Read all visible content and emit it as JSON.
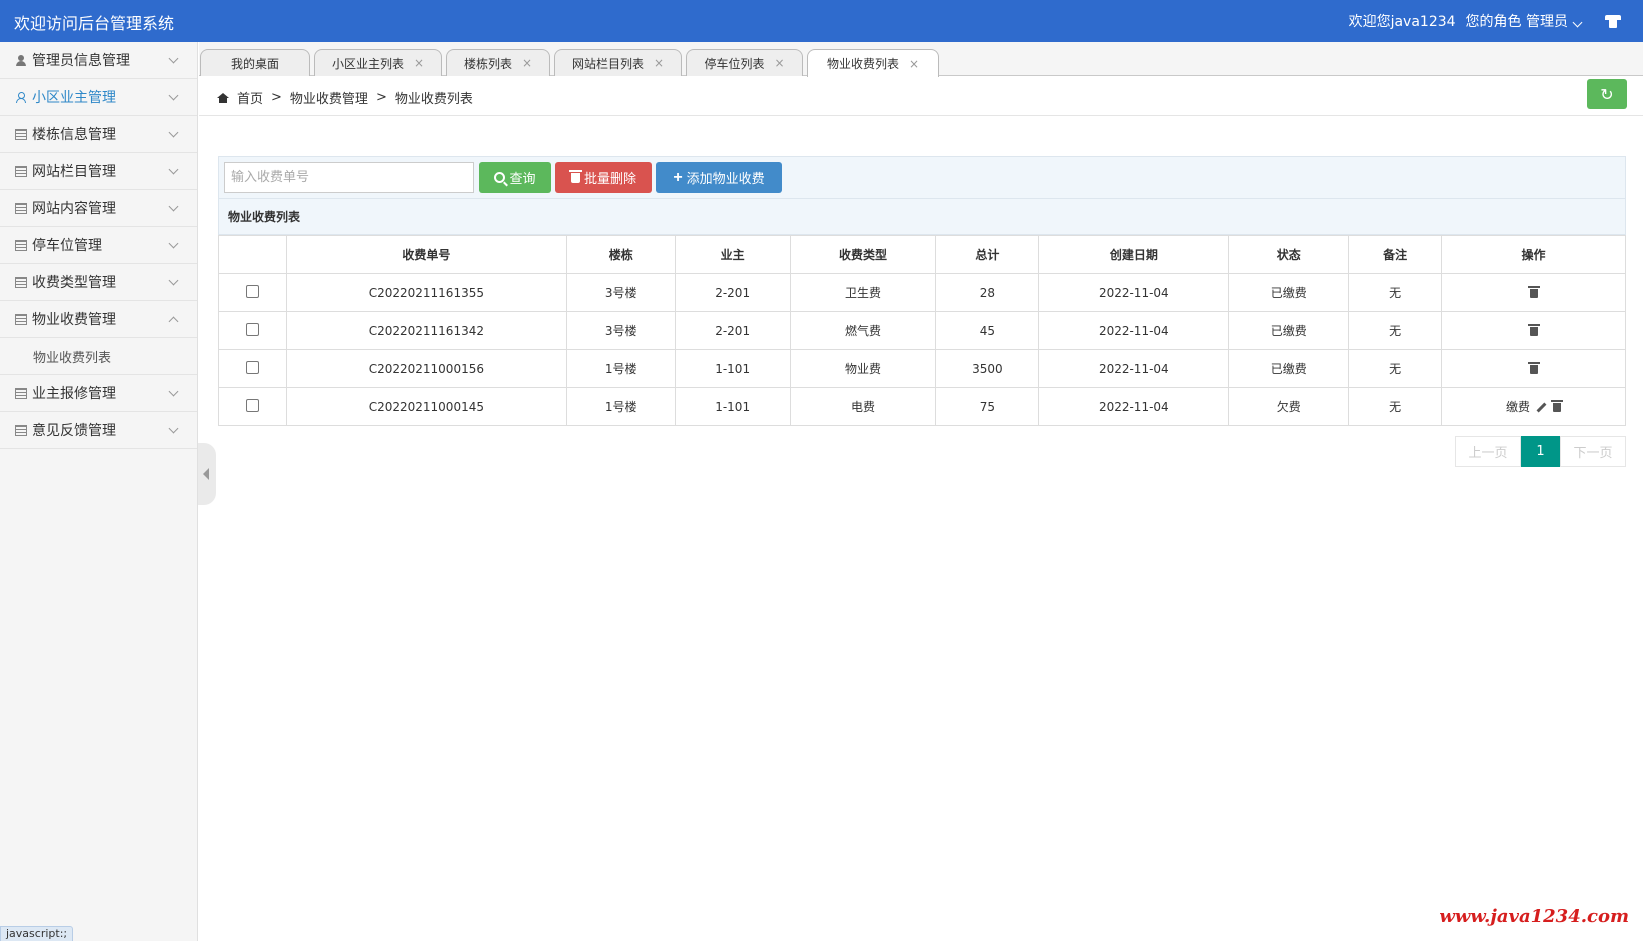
{
  "header": {
    "title": "欢迎访问后台管理系统",
    "welcome": "欢迎您java1234",
    "role": "您的角色 管理员"
  },
  "sidebar": {
    "items": [
      {
        "label": "管理员信息管理",
        "icon": "user-icon"
      },
      {
        "label": "小区业主管理",
        "icon": "user-outline-icon",
        "active": true
      },
      {
        "label": "楼栋信息管理",
        "icon": "list-icon"
      },
      {
        "label": "网站栏目管理",
        "icon": "list-icon"
      },
      {
        "label": "网站内容管理",
        "icon": "list-icon"
      },
      {
        "label": "停车位管理",
        "icon": "list-icon"
      },
      {
        "label": "收费类型管理",
        "icon": "list-icon"
      },
      {
        "label": "物业收费管理",
        "icon": "list-icon",
        "expanded": true
      },
      {
        "label": "业主报修管理",
        "icon": "list-icon"
      },
      {
        "label": "意见反馈管理",
        "icon": "list-icon"
      }
    ],
    "sub_item": "物业收费列表"
  },
  "status_tip": "javascript:;",
  "tabs": [
    {
      "label": "我的桌面"
    },
    {
      "label": "小区业主列表"
    },
    {
      "label": "楼栋列表"
    },
    {
      "label": "网站栏目列表"
    },
    {
      "label": "停车位列表"
    },
    {
      "label": "物业收费列表",
      "active": true
    }
  ],
  "tab_close": "×",
  "breadcrumb": {
    "home": "首页",
    "sep": ">",
    "level1": "物业收费管理",
    "level2": "物业收费列表"
  },
  "toolbar": {
    "search_placeholder": "输入收费单号",
    "query_label": "查询",
    "batch_delete_label": "批量删除",
    "add_label": "添加物业收费"
  },
  "list_title": "物业收费列表",
  "table": {
    "headers": [
      "收费单号",
      "楼栋",
      "业主",
      "收费类型",
      "总计",
      "创建日期",
      "状态",
      "备注",
      "操作"
    ],
    "rows": [
      {
        "no": "C20220211161355",
        "building": "3号楼",
        "owner": "2-201",
        "type": "卫生费",
        "total": "28",
        "date": "2022-11-04",
        "status": "已缴费",
        "remark": "无"
      },
      {
        "no": "C20220211161342",
        "building": "3号楼",
        "owner": "2-201",
        "type": "燃气费",
        "total": "45",
        "date": "2022-11-04",
        "status": "已缴费",
        "remark": "无"
      },
      {
        "no": "C20220211000156",
        "building": "1号楼",
        "owner": "1-101",
        "type": "物业费",
        "total": "3500",
        "date": "2022-11-04",
        "status": "已缴费",
        "remark": "无"
      },
      {
        "no": "C20220211000145",
        "building": "1号楼",
        "owner": "1-101",
        "type": "电费",
        "total": "75",
        "date": "2022-11-04",
        "status": "欠费",
        "remark": "无",
        "pay_label": "缴费"
      }
    ]
  },
  "pager": {
    "prev": "上一页",
    "current": "1",
    "next": "下一页"
  },
  "watermark": "www.java1234.com"
}
